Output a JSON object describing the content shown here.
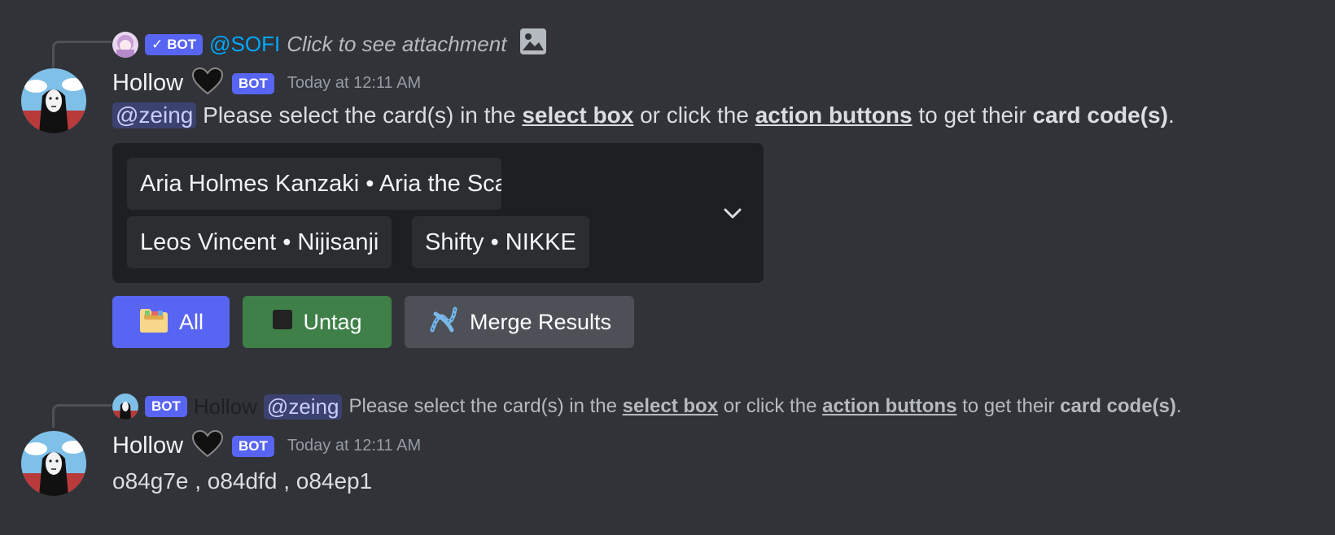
{
  "reply1": {
    "bot_label": "BOT",
    "mention": "@SOFI",
    "text": "Click to see attachment",
    "attachment_icon": "image-icon"
  },
  "message1": {
    "username": "Hollow",
    "bot_label": "BOT",
    "timestamp": "Today at 12:11 AM",
    "mention": "@zeing",
    "parts": {
      "p1": "Please select the card(s) in the",
      "u1": "select box",
      "p2": "or click the",
      "u2": "action buttons",
      "p3": "to get their",
      "b1": "card code(s)",
      "p4": "."
    },
    "select_options": [
      "Aria Holmes Kanzaki • Aria the Scarlet Ammo",
      "Leos Vincent • Nijisanji",
      "Shifty • NIKKE"
    ],
    "buttons": {
      "all": "All",
      "untag": "Untag",
      "merge": "Merge Results"
    },
    "colors": {
      "all": "#5865f2",
      "untag": "#3e8048",
      "merge": "#4e5058"
    }
  },
  "reply2": {
    "bot_label": "BOT",
    "username": "Hollow",
    "mention": "@zeing",
    "parts": {
      "p1": "Please select the card(s) in the",
      "u1": "select box",
      "p2": "or click the",
      "u2": "action buttons",
      "p3": "to get their",
      "b1": "card code(s)",
      "p4": "."
    }
  },
  "message2": {
    "username": "Hollow",
    "bot_label": "BOT",
    "timestamp": "Today at 12:11 AM",
    "content": "o84g7e , o84dfd , o84ep1"
  }
}
